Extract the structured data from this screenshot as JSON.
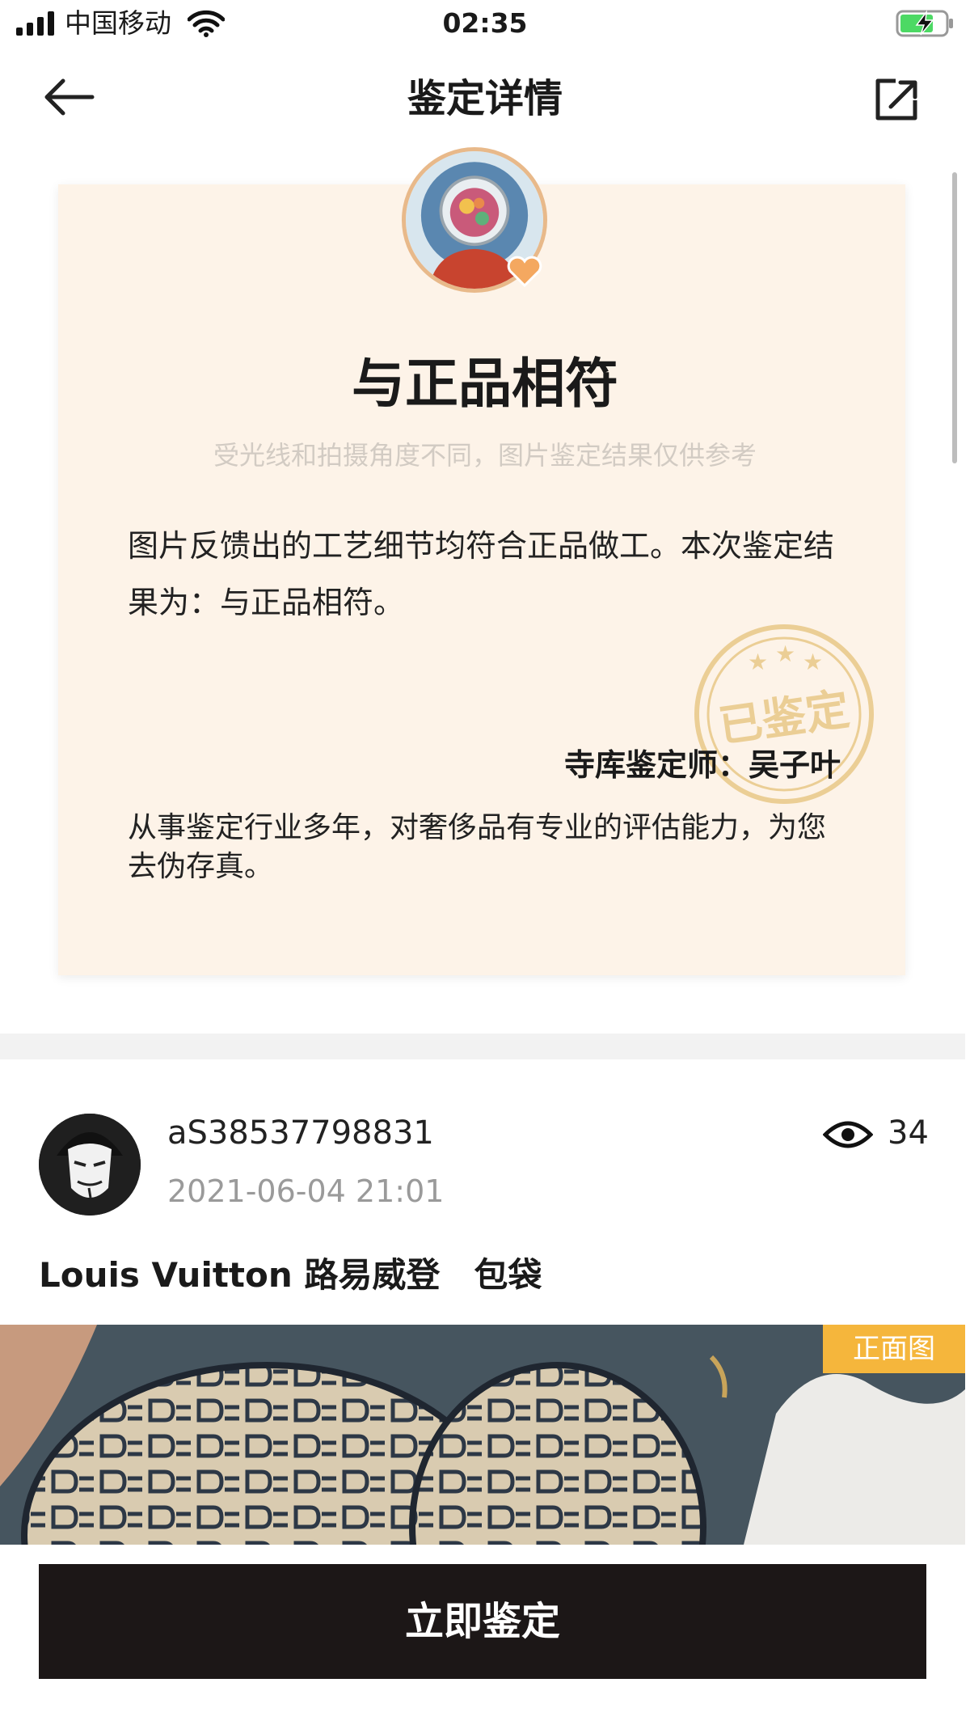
{
  "status_bar": {
    "carrier": "中国移动",
    "time": "02:35",
    "icons": [
      "signal-icon",
      "wifi-icon",
      "battery-charging-icon"
    ],
    "battery_color": "#4cd964"
  },
  "nav": {
    "title": "鉴定详情",
    "icons": [
      "back-arrow-icon",
      "share-icon"
    ]
  },
  "result_card": {
    "title": "与正品相符",
    "disclaimer": "受光线和拍摄角度不同，图片鉴定结果仅供参考",
    "description": "图片反馈出的工艺细节均符合正品做工。本次鉴定结果为：与正品相符。",
    "stamp_text": "已鉴定",
    "appraiser_line": "寺库鉴定师：吴子叶",
    "appraiser_bio": "从事鉴定行业多年，对奢侈品有专业的评估能力，为您去伪存真。",
    "background_color": "#fdf3e8",
    "stamp_color": "#e6c27a"
  },
  "post": {
    "username": "aS38537798831",
    "time": "2021-06-04 21:01",
    "views": "34",
    "brand": "Louis Vuitton 路易威登",
    "category": "包袋",
    "image_tag": "正面图",
    "tag_color": "#f5b63c"
  },
  "cta": {
    "label": "立即鉴定",
    "color": "#1c1717"
  }
}
